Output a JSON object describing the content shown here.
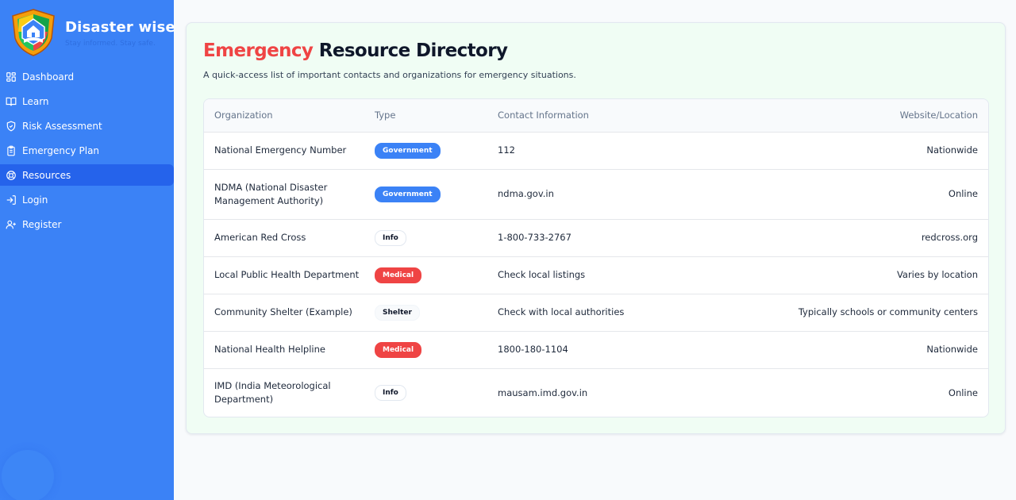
{
  "brand": {
    "title": "Disaster wise",
    "tagline": "Stay informed. Stay safe."
  },
  "nav": [
    {
      "label": "Dashboard",
      "icon": "dashboard-icon",
      "active": false
    },
    {
      "label": "Learn",
      "icon": "book-icon",
      "active": false
    },
    {
      "label": "Risk Assessment",
      "icon": "shield-icon",
      "active": false
    },
    {
      "label": "Emergency Plan",
      "icon": "clipboard-icon",
      "active": false
    },
    {
      "label": "Resources",
      "icon": "lifebuoy-icon",
      "active": true
    },
    {
      "label": "Login",
      "icon": "login-icon",
      "active": false
    },
    {
      "label": "Register",
      "icon": "user-plus-icon",
      "active": false
    }
  ],
  "page": {
    "title_accent": "Emergency",
    "title_rest": " Resource Directory",
    "subtitle": "A quick-access list of important contacts and organizations for emergency situations."
  },
  "table": {
    "headers": [
      "Organization",
      "Type",
      "Contact Information",
      "Website/Location"
    ],
    "rows": [
      {
        "org": "National Emergency Number",
        "type": "Government",
        "contact": "112",
        "location": "Nationwide"
      },
      {
        "org": "NDMA (National Disaster Management Authority)",
        "type": "Government",
        "contact": "ndma.gov.in",
        "location": "Online"
      },
      {
        "org": "American Red Cross",
        "type": "Info",
        "contact": "1-800-733-2767",
        "location": "redcross.org"
      },
      {
        "org": "Local Public Health Department",
        "type": "Medical",
        "contact": "Check local listings",
        "location": "Varies by location"
      },
      {
        "org": "Community Shelter (Example)",
        "type": "Shelter",
        "contact": "Check with local authorities",
        "location": "Typically schools or community centers"
      },
      {
        "org": "National Health Helpline",
        "type": "Medical",
        "contact": "1800-180-1104",
        "location": "Nationwide"
      },
      {
        "org": "IMD (India Meteorological Department)",
        "type": "Info",
        "contact": "mausam.imd.gov.in",
        "location": "Online"
      }
    ]
  },
  "badge_styles": {
    "Government": {
      "bg": "#3b82f6",
      "fg": "#ffffff",
      "border": "#3b82f6"
    },
    "Medical": {
      "bg": "#ef4444",
      "fg": "#ffffff",
      "border": "#ef4444"
    },
    "Info": {
      "bg": "#ffffff",
      "fg": "#0f172a",
      "border": "#e2e8f0"
    },
    "Shelter": {
      "bg": "#f8fafc",
      "fg": "#0f172a",
      "border": "#f1f5f9"
    }
  },
  "colors": {
    "sidebar": "#3b82f6",
    "sidebar_active": "#2563eb",
    "accent_red": "#ef4444",
    "card_bg": "#f0fdf4"
  }
}
